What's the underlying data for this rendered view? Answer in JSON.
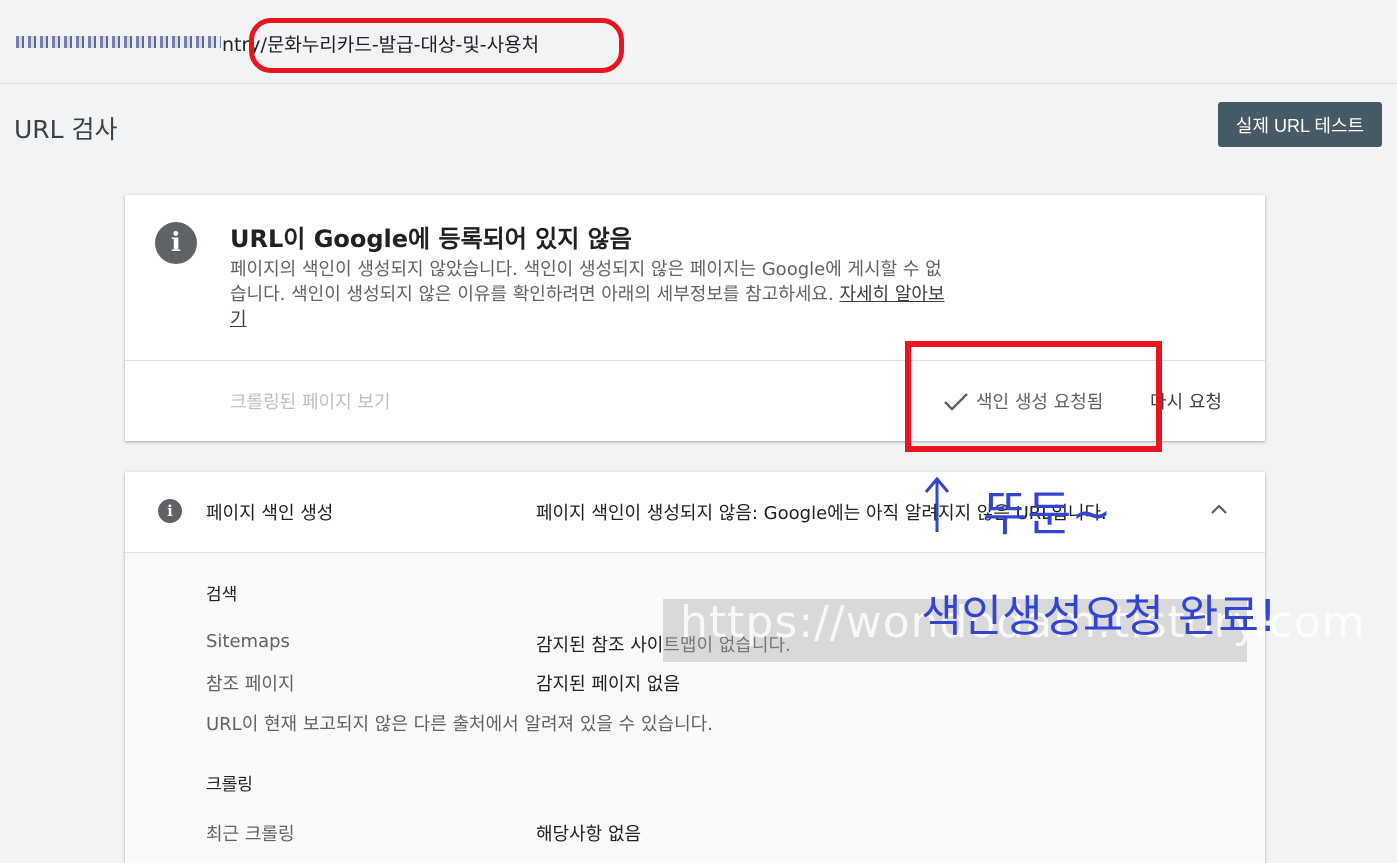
{
  "address_bar": {
    "url_path": "ntry/문화누리카드-발급-대상-및-사용처"
  },
  "header": {
    "page_title": "URL 검사",
    "test_button_label": "실제 URL 테스트"
  },
  "status_card": {
    "title": "URL이 Google에 등록되어 있지 않음",
    "description": "페이지의 색인이 생성되지 않았습니다. 색인이 생성되지 않은 페이지는 Google에 게시할 수 없습니다. 색인이 생성되지 않은 이유를 확인하려면 아래의 세부정보를 참고하세요.",
    "learn_more": "자세히 알아보기",
    "view_crawled": "크롤링된 페이지 보기",
    "index_requested": "색인 생성 요청됨",
    "request_again": "다시 요청"
  },
  "coverage_card": {
    "label": "페이지 색인 생성",
    "value": "페이지 색인이 생성되지 않음: Google에는 아직 알려지지 않은 URL입니다.",
    "discovery_heading": "검색",
    "sitemaps_label": "Sitemaps",
    "sitemaps_value": "감지된 참조 사이트맵이 없습니다.",
    "referring_label": "참조 페이지",
    "referring_value": "감지된 페이지 없음",
    "note": "URL이 현재 보고되지 않은 다른 출처에서 알려져 있을 수 있습니다.",
    "crawl_heading": "크롤링",
    "last_crawl_label": "최근 크롤링",
    "last_crawl_value": "해당사항 없음"
  },
  "annotations": {
    "arrow_text": "뚜둔~",
    "done_text": "색인생성요청 완료!",
    "watermark": "https://wondodam.tistory.com",
    "color": "#3444d0",
    "highlight_color": "#e8141e"
  },
  "icons": [
    "info-icon",
    "check-icon",
    "chevron-up-icon"
  ]
}
